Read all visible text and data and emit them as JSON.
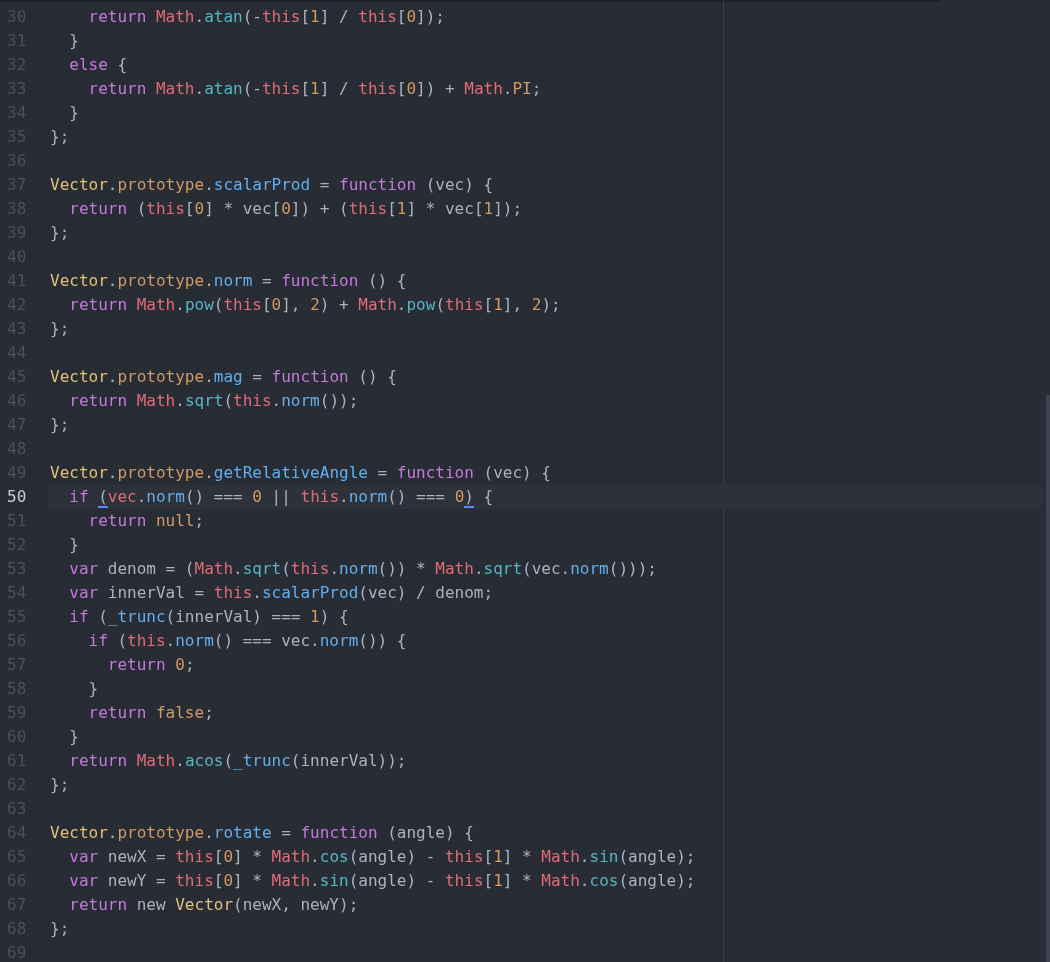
{
  "editor": {
    "lines": [
      {
        "number": "30",
        "current": false,
        "tokens": [
          {
            "kind": "keyword",
            "text": "    return "
          },
          {
            "kind": "object",
            "text": "Math"
          },
          {
            "kind": "plain",
            "text": "."
          },
          {
            "kind": "builtin",
            "text": "atan"
          },
          {
            "kind": "plain",
            "text": "(-"
          },
          {
            "kind": "object",
            "text": "this"
          },
          {
            "kind": "plain",
            "text": "["
          },
          {
            "kind": "number",
            "text": "1"
          },
          {
            "kind": "plain",
            "text": "] / "
          },
          {
            "kind": "object",
            "text": "this"
          },
          {
            "kind": "plain",
            "text": "["
          },
          {
            "kind": "number",
            "text": "0"
          },
          {
            "kind": "plain",
            "text": "]);"
          }
        ]
      },
      {
        "number": "31",
        "current": false,
        "tokens": [
          {
            "kind": "plain",
            "text": "  }"
          }
        ]
      },
      {
        "number": "32",
        "current": false,
        "tokens": [
          {
            "kind": "keyword",
            "text": "  else"
          },
          {
            "kind": "plain",
            "text": " {"
          }
        ]
      },
      {
        "number": "33",
        "current": false,
        "tokens": [
          {
            "kind": "keyword",
            "text": "    return "
          },
          {
            "kind": "object",
            "text": "Math"
          },
          {
            "kind": "plain",
            "text": "."
          },
          {
            "kind": "builtin",
            "text": "atan"
          },
          {
            "kind": "plain",
            "text": "(-"
          },
          {
            "kind": "object",
            "text": "this"
          },
          {
            "kind": "plain",
            "text": "["
          },
          {
            "kind": "number",
            "text": "1"
          },
          {
            "kind": "plain",
            "text": "] / "
          },
          {
            "kind": "object",
            "text": "this"
          },
          {
            "kind": "plain",
            "text": "["
          },
          {
            "kind": "number",
            "text": "0"
          },
          {
            "kind": "plain",
            "text": "]) + "
          },
          {
            "kind": "object",
            "text": "Math"
          },
          {
            "kind": "plain",
            "text": "."
          },
          {
            "kind": "property",
            "text": "PI"
          },
          {
            "kind": "plain",
            "text": ";"
          }
        ]
      },
      {
        "number": "34",
        "current": false,
        "tokens": [
          {
            "kind": "plain",
            "text": "  }"
          }
        ]
      },
      {
        "number": "35",
        "current": false,
        "tokens": [
          {
            "kind": "plain",
            "text": "};"
          }
        ]
      },
      {
        "number": "36",
        "current": false
      },
      {
        "number": "37",
        "current": false,
        "tokens": [
          {
            "kind": "class",
            "text": "Vector"
          },
          {
            "kind": "plain",
            "text": "."
          },
          {
            "kind": "property",
            "text": "prototype"
          },
          {
            "kind": "plain",
            "text": "."
          },
          {
            "kind": "function",
            "text": "scalarProd"
          },
          {
            "kind": "plain",
            "text": " = "
          },
          {
            "kind": "keyword",
            "text": "function"
          },
          {
            "kind": "plain",
            "text": " (vec) {"
          }
        ]
      },
      {
        "number": "38",
        "current": false,
        "tokens": [
          {
            "kind": "keyword",
            "text": "  return"
          },
          {
            "kind": "plain",
            "text": " ("
          },
          {
            "kind": "object",
            "text": "this"
          },
          {
            "kind": "plain",
            "text": "["
          },
          {
            "kind": "number",
            "text": "0"
          },
          {
            "kind": "plain",
            "text": "] * vec["
          },
          {
            "kind": "number",
            "text": "0"
          },
          {
            "kind": "plain",
            "text": "]) + ("
          },
          {
            "kind": "object",
            "text": "this"
          },
          {
            "kind": "plain",
            "text": "["
          },
          {
            "kind": "number",
            "text": "1"
          },
          {
            "kind": "plain",
            "text": "] * vec["
          },
          {
            "kind": "number",
            "text": "1"
          },
          {
            "kind": "plain",
            "text": "]);"
          }
        ]
      },
      {
        "number": "39",
        "current": false,
        "tokens": [
          {
            "kind": "plain",
            "text": "};"
          }
        ]
      },
      {
        "number": "40",
        "current": false
      },
      {
        "number": "41",
        "current": false,
        "tokens": [
          {
            "kind": "class",
            "text": "Vector"
          },
          {
            "kind": "plain",
            "text": "."
          },
          {
            "kind": "property",
            "text": "prototype"
          },
          {
            "kind": "plain",
            "text": "."
          },
          {
            "kind": "function",
            "text": "norm"
          },
          {
            "kind": "plain",
            "text": " = "
          },
          {
            "kind": "keyword",
            "text": "function"
          },
          {
            "kind": "plain",
            "text": " () {"
          }
        ]
      },
      {
        "number": "42",
        "current": false,
        "tokens": [
          {
            "kind": "keyword",
            "text": "  return "
          },
          {
            "kind": "object",
            "text": "Math"
          },
          {
            "kind": "plain",
            "text": "."
          },
          {
            "kind": "builtin",
            "text": "pow"
          },
          {
            "kind": "plain",
            "text": "("
          },
          {
            "kind": "object",
            "text": "this"
          },
          {
            "kind": "plain",
            "text": "["
          },
          {
            "kind": "number",
            "text": "0"
          },
          {
            "kind": "plain",
            "text": "], "
          },
          {
            "kind": "number",
            "text": "2"
          },
          {
            "kind": "plain",
            "text": ") + "
          },
          {
            "kind": "object",
            "text": "Math"
          },
          {
            "kind": "plain",
            "text": "."
          },
          {
            "kind": "builtin",
            "text": "pow"
          },
          {
            "kind": "plain",
            "text": "("
          },
          {
            "kind": "object",
            "text": "this"
          },
          {
            "kind": "plain",
            "text": "["
          },
          {
            "kind": "number",
            "text": "1"
          },
          {
            "kind": "plain",
            "text": "], "
          },
          {
            "kind": "number",
            "text": "2"
          },
          {
            "kind": "plain",
            "text": ");"
          }
        ]
      },
      {
        "number": "43",
        "current": false,
        "tokens": [
          {
            "kind": "plain",
            "text": "};"
          }
        ]
      },
      {
        "number": "44",
        "current": false
      },
      {
        "number": "45",
        "current": false,
        "tokens": [
          {
            "kind": "class",
            "text": "Vector"
          },
          {
            "kind": "plain",
            "text": "."
          },
          {
            "kind": "property",
            "text": "prototype"
          },
          {
            "kind": "plain",
            "text": "."
          },
          {
            "kind": "function",
            "text": "mag"
          },
          {
            "kind": "plain",
            "text": " = "
          },
          {
            "kind": "keyword",
            "text": "function"
          },
          {
            "kind": "plain",
            "text": " () {"
          }
        ]
      },
      {
        "number": "46",
        "current": false,
        "tokens": [
          {
            "kind": "keyword",
            "text": "  return "
          },
          {
            "kind": "object",
            "text": "Math"
          },
          {
            "kind": "plain",
            "text": "."
          },
          {
            "kind": "builtin",
            "text": "sqrt"
          },
          {
            "kind": "plain",
            "text": "("
          },
          {
            "kind": "object",
            "text": "this"
          },
          {
            "kind": "plain",
            "text": "."
          },
          {
            "kind": "function",
            "text": "norm"
          },
          {
            "kind": "plain",
            "text": "());"
          }
        ]
      },
      {
        "number": "47",
        "current": false,
        "tokens": [
          {
            "kind": "plain",
            "text": "};"
          }
        ]
      },
      {
        "number": "48",
        "current": false
      },
      {
        "number": "49",
        "current": false,
        "tokens": [
          {
            "kind": "class",
            "text": "Vector"
          },
          {
            "kind": "plain",
            "text": "."
          },
          {
            "kind": "property",
            "text": "prototype"
          },
          {
            "kind": "plain",
            "text": "."
          },
          {
            "kind": "function",
            "text": "getRelativeAngle"
          },
          {
            "kind": "plain",
            "text": " = "
          },
          {
            "kind": "keyword",
            "text": "function"
          },
          {
            "kind": "plain",
            "text": " (vec) {"
          }
        ]
      },
      {
        "number": "50",
        "current": true,
        "tokens": [
          {
            "kind": "keyword",
            "text": "  if "
          },
          {
            "kind": "bracket-match",
            "text": "("
          },
          {
            "kind": "object",
            "text": "vec"
          },
          {
            "kind": "plain",
            "text": "."
          },
          {
            "kind": "function",
            "text": "norm"
          },
          {
            "kind": "plain",
            "text": "() === "
          },
          {
            "kind": "number",
            "text": "0"
          },
          {
            "kind": "plain",
            "text": " || "
          },
          {
            "kind": "object",
            "text": "this"
          },
          {
            "kind": "plain",
            "text": "."
          },
          {
            "kind": "function",
            "text": "norm"
          },
          {
            "kind": "plain",
            "text": "() === "
          },
          {
            "kind": "number",
            "text": "0"
          },
          {
            "kind": "bracket-match",
            "text": ")"
          },
          {
            "kind": "plain",
            "text": " {"
          }
        ]
      },
      {
        "number": "51",
        "current": false,
        "tokens": [
          {
            "kind": "keyword",
            "text": "    return "
          },
          {
            "kind": "number",
            "text": "null"
          },
          {
            "kind": "plain",
            "text": ";"
          }
        ]
      },
      {
        "number": "52",
        "current": false,
        "tokens": [
          {
            "kind": "plain",
            "text": "  }"
          }
        ]
      },
      {
        "number": "53",
        "current": false,
        "tokens": [
          {
            "kind": "keyword",
            "text": "  var"
          },
          {
            "kind": "plain",
            "text": " denom = ("
          },
          {
            "kind": "object",
            "text": "Math"
          },
          {
            "kind": "plain",
            "text": "."
          },
          {
            "kind": "builtin",
            "text": "sqrt"
          },
          {
            "kind": "plain",
            "text": "("
          },
          {
            "kind": "object",
            "text": "this"
          },
          {
            "kind": "plain",
            "text": "."
          },
          {
            "kind": "function",
            "text": "norm"
          },
          {
            "kind": "plain",
            "text": "()) * "
          },
          {
            "kind": "object",
            "text": "Math"
          },
          {
            "kind": "plain",
            "text": "."
          },
          {
            "kind": "builtin",
            "text": "sqrt"
          },
          {
            "kind": "plain",
            "text": "(vec."
          },
          {
            "kind": "function",
            "text": "norm"
          },
          {
            "kind": "plain",
            "text": "()));"
          }
        ]
      },
      {
        "number": "54",
        "current": false,
        "tokens": [
          {
            "kind": "keyword",
            "text": "  var"
          },
          {
            "kind": "plain",
            "text": " innerVal = "
          },
          {
            "kind": "object",
            "text": "this"
          },
          {
            "kind": "plain",
            "text": "."
          },
          {
            "kind": "function",
            "text": "scalarProd"
          },
          {
            "kind": "plain",
            "text": "(vec) / denom;"
          }
        ]
      },
      {
        "number": "55",
        "current": false,
        "tokens": [
          {
            "kind": "keyword",
            "text": "  if"
          },
          {
            "kind": "plain",
            "text": " ("
          },
          {
            "kind": "function",
            "text": "_trunc"
          },
          {
            "kind": "plain",
            "text": "(innerVal) === "
          },
          {
            "kind": "number",
            "text": "1"
          },
          {
            "kind": "plain",
            "text": ") {"
          }
        ]
      },
      {
        "number": "56",
        "current": false,
        "tokens": [
          {
            "kind": "keyword",
            "text": "    if"
          },
          {
            "kind": "plain",
            "text": " ("
          },
          {
            "kind": "object",
            "text": "this"
          },
          {
            "kind": "plain",
            "text": "."
          },
          {
            "kind": "function",
            "text": "norm"
          },
          {
            "kind": "plain",
            "text": "() === vec."
          },
          {
            "kind": "function",
            "text": "norm"
          },
          {
            "kind": "plain",
            "text": "()) {"
          }
        ]
      },
      {
        "number": "57",
        "current": false,
        "tokens": [
          {
            "kind": "keyword",
            "text": "      return "
          },
          {
            "kind": "number",
            "text": "0"
          },
          {
            "kind": "plain",
            "text": ";"
          }
        ]
      },
      {
        "number": "58",
        "current": false,
        "tokens": [
          {
            "kind": "plain",
            "text": "    }"
          }
        ]
      },
      {
        "number": "59",
        "current": false,
        "tokens": [
          {
            "kind": "keyword",
            "text": "    return "
          },
          {
            "kind": "number",
            "text": "false"
          },
          {
            "kind": "plain",
            "text": ";"
          }
        ]
      },
      {
        "number": "60",
        "current": false,
        "tokens": [
          {
            "kind": "plain",
            "text": "  }"
          }
        ]
      },
      {
        "number": "61",
        "current": false,
        "tokens": [
          {
            "kind": "keyword",
            "text": "  return "
          },
          {
            "kind": "object",
            "text": "Math"
          },
          {
            "kind": "plain",
            "text": "."
          },
          {
            "kind": "builtin",
            "text": "acos"
          },
          {
            "kind": "plain",
            "text": "("
          },
          {
            "kind": "function",
            "text": "_trunc"
          },
          {
            "kind": "plain",
            "text": "(innerVal));"
          }
        ]
      },
      {
        "number": "62",
        "current": false,
        "tokens": [
          {
            "kind": "plain",
            "text": "};"
          }
        ]
      },
      {
        "number": "63",
        "current": false
      },
      {
        "number": "64",
        "current": false,
        "tokens": [
          {
            "kind": "class",
            "text": "Vector"
          },
          {
            "kind": "plain",
            "text": "."
          },
          {
            "kind": "property",
            "text": "prototype"
          },
          {
            "kind": "plain",
            "text": "."
          },
          {
            "kind": "function",
            "text": "rotate"
          },
          {
            "kind": "plain",
            "text": " = "
          },
          {
            "kind": "keyword",
            "text": "function"
          },
          {
            "kind": "plain",
            "text": " (angle) {"
          }
        ]
      },
      {
        "number": "65",
        "current": false,
        "tokens": [
          {
            "kind": "keyword",
            "text": "  var"
          },
          {
            "kind": "plain",
            "text": " newX = "
          },
          {
            "kind": "object",
            "text": "this"
          },
          {
            "kind": "plain",
            "text": "["
          },
          {
            "kind": "number",
            "text": "0"
          },
          {
            "kind": "plain",
            "text": "] * "
          },
          {
            "kind": "object",
            "text": "Math"
          },
          {
            "kind": "plain",
            "text": "."
          },
          {
            "kind": "builtin",
            "text": "cos"
          },
          {
            "kind": "plain",
            "text": "(angle) - "
          },
          {
            "kind": "object",
            "text": "this"
          },
          {
            "kind": "plain",
            "text": "["
          },
          {
            "kind": "number",
            "text": "1"
          },
          {
            "kind": "plain",
            "text": "] * "
          },
          {
            "kind": "object",
            "text": "Math"
          },
          {
            "kind": "plain",
            "text": "."
          },
          {
            "kind": "builtin",
            "text": "sin"
          },
          {
            "kind": "plain",
            "text": "(angle);"
          }
        ]
      },
      {
        "number": "66",
        "current": false,
        "tokens": [
          {
            "kind": "keyword",
            "text": "  var"
          },
          {
            "kind": "plain",
            "text": " newY = "
          },
          {
            "kind": "object",
            "text": "this"
          },
          {
            "kind": "plain",
            "text": "["
          },
          {
            "kind": "number",
            "text": "0"
          },
          {
            "kind": "plain",
            "text": "] * "
          },
          {
            "kind": "object",
            "text": "Math"
          },
          {
            "kind": "plain",
            "text": "."
          },
          {
            "kind": "builtin",
            "text": "sin"
          },
          {
            "kind": "plain",
            "text": "(angle) - "
          },
          {
            "kind": "object",
            "text": "this"
          },
          {
            "kind": "plain",
            "text": "["
          },
          {
            "kind": "number",
            "text": "1"
          },
          {
            "kind": "plain",
            "text": "] * "
          },
          {
            "kind": "object",
            "text": "Math"
          },
          {
            "kind": "plain",
            "text": "."
          },
          {
            "kind": "builtin",
            "text": "cos"
          },
          {
            "kind": "plain",
            "text": "(angle);"
          }
        ]
      },
      {
        "number": "67",
        "current": false,
        "tokens": [
          {
            "kind": "keyword",
            "text": "  return"
          },
          {
            "kind": "plain",
            "text": " new "
          },
          {
            "kind": "class",
            "text": "Vector"
          },
          {
            "kind": "plain",
            "text": "(newX, newY);"
          }
        ]
      },
      {
        "number": "68",
        "current": false,
        "tokens": [
          {
            "kind": "plain",
            "text": "};"
          }
        ]
      },
      {
        "number": "69",
        "current": false
      }
    ]
  }
}
